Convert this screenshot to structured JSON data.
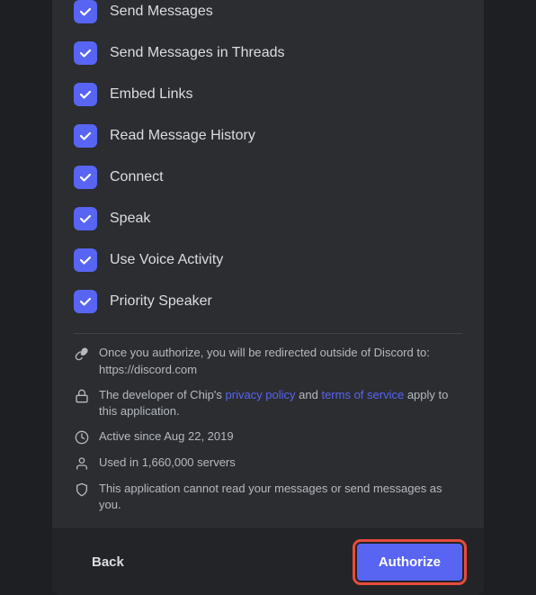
{
  "permissions": [
    {
      "label": "Send Messages"
    },
    {
      "label": "Send Messages in Threads"
    },
    {
      "label": "Embed Links"
    },
    {
      "label": "Read Message History"
    },
    {
      "label": "Connect"
    },
    {
      "label": "Speak"
    },
    {
      "label": "Use Voice Activity"
    },
    {
      "label": "Priority Speaker"
    }
  ],
  "info": [
    {
      "icon": "link",
      "text": "Once you authorize, you will be redirected outside of Discord to: https://discord.com"
    },
    {
      "icon": "lock",
      "text_before": "The developer of Chip's ",
      "link1_text": "privacy policy",
      "link1_href": "#",
      "text_middle": " and ",
      "link2_text": "terms of service",
      "link2_href": "#",
      "text_after": " apply to this application."
    },
    {
      "icon": "clock",
      "text": "Active since Aug 22, 2019"
    },
    {
      "icon": "person",
      "text": "Used in 1,660,000 servers"
    },
    {
      "icon": "shield",
      "text": "This application cannot read your messages or send messages as you."
    }
  ],
  "footer": {
    "back_label": "Back",
    "authorize_label": "Authorize"
  }
}
